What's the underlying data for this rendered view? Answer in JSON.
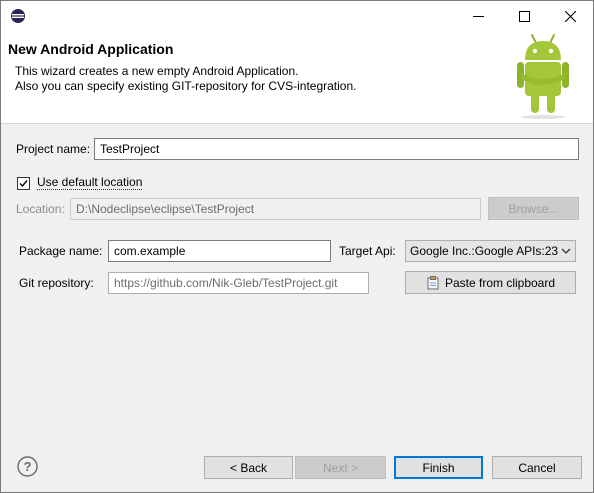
{
  "window": {
    "controls": {
      "minimize": "minimize-icon",
      "maximize": "maximize-icon",
      "close": "close-icon"
    }
  },
  "header": {
    "title": "New Android Application",
    "desc_line1": "This wizard creates a new empty Android Application.",
    "desc_line2": "Also you can specify existing GIT-repository for CVS-integration."
  },
  "form": {
    "project_name_label": "Project name:",
    "project_name_value": "TestProject",
    "use_default_label": "Use default location",
    "use_default_checked": true,
    "location_label": "Location:",
    "location_value": "D:\\Nodeclipse\\eclipse\\TestProject",
    "browse_label": "Browse...",
    "package_label": "Package name:",
    "package_value": "com.example",
    "target_api_label": "Target Api:",
    "target_api_value": "Google Inc.:Google APIs:23",
    "git_label": "Git repository:",
    "git_value": "https://github.com/Nik-Gleb/TestProject.git",
    "paste_label": "Paste from clipboard"
  },
  "footer": {
    "back_label": "< Back",
    "next_label": "Next >",
    "finish_label": "Finish",
    "cancel_label": "Cancel"
  },
  "colors": {
    "accent": "#0078d7",
    "android_green": "#a4c639"
  }
}
